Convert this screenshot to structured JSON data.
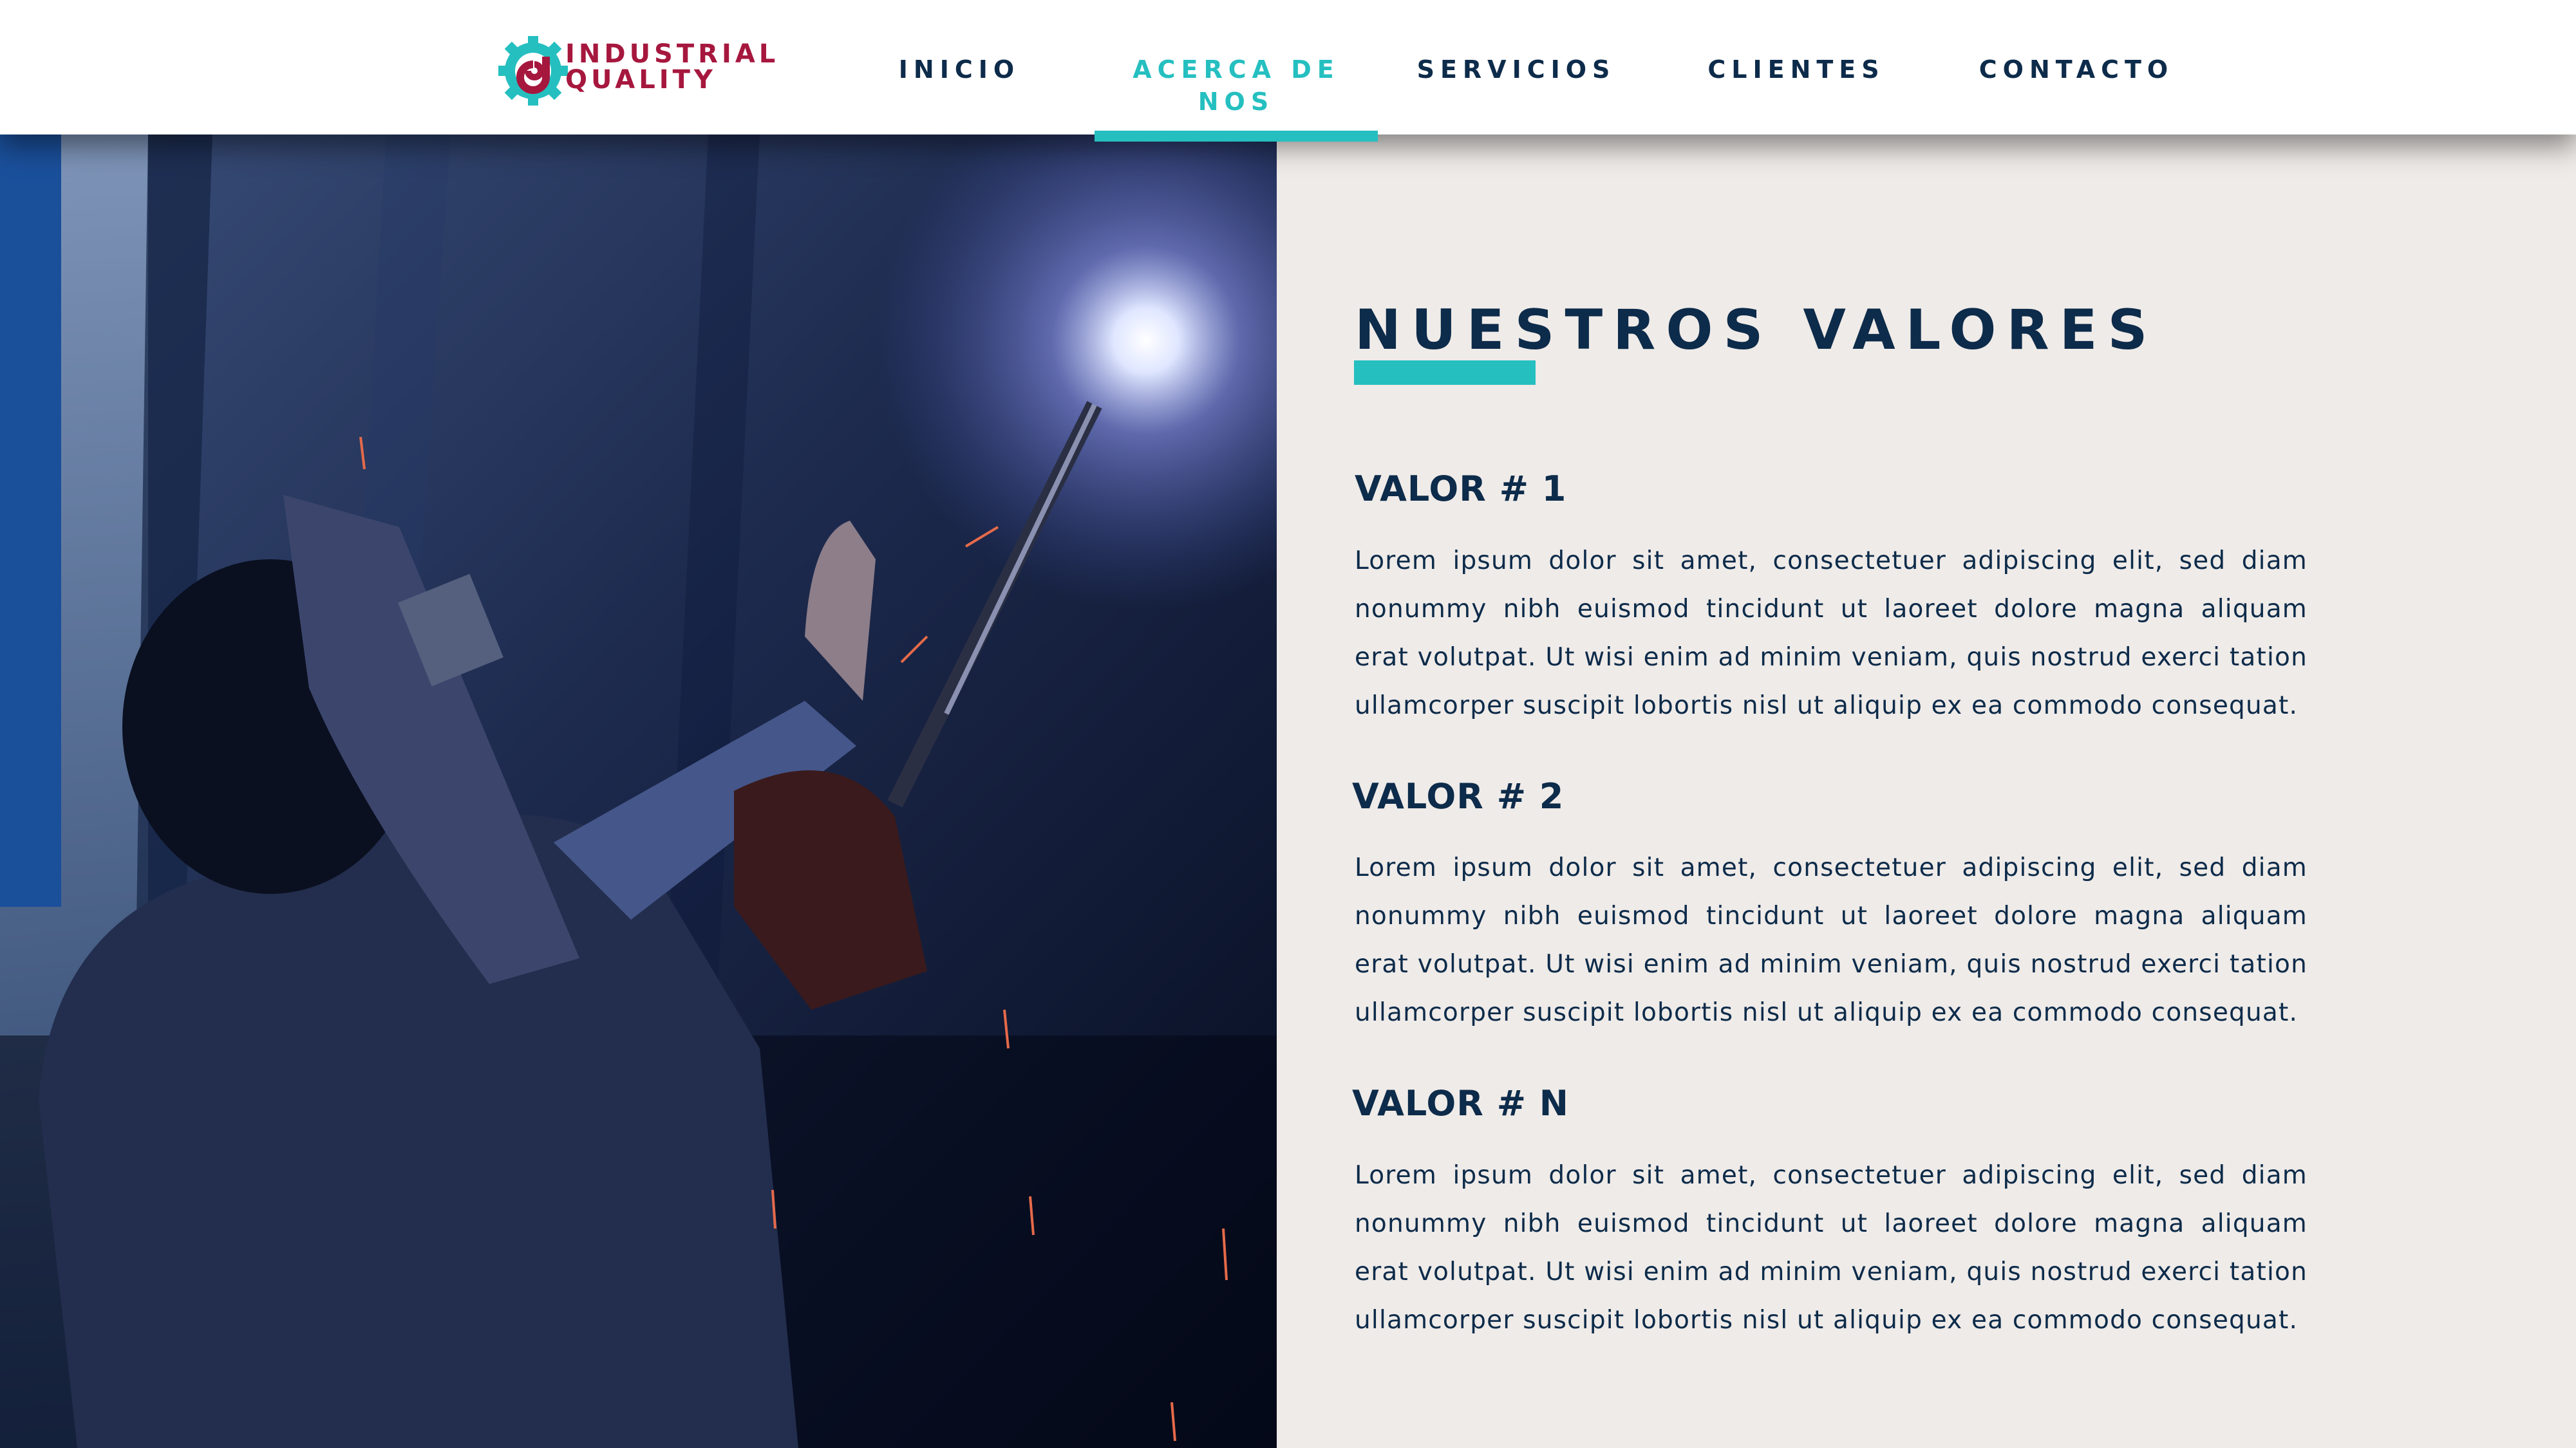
{
  "brand": {
    "line1": "INDUSTRIAL",
    "line2": "QUALITY",
    "colors": {
      "primary": "#a6173e",
      "accent": "#25bfc0"
    }
  },
  "nav": {
    "items": [
      {
        "label": "INICIO",
        "active": false
      },
      {
        "label": "ACERCA DE NOS",
        "active": true
      },
      {
        "label": "SERVICIOS",
        "active": false
      },
      {
        "label": "CLIENTES",
        "active": false
      },
      {
        "label": "CONTACTO",
        "active": false
      }
    ]
  },
  "hero_image": {
    "icon": "welder-photo"
  },
  "section": {
    "title": "NUESTROS VALORES",
    "values": [
      {
        "title": "VALOR # 1",
        "text": "Lorem ipsum dolor sit amet, consectetuer adipiscing elit, sed diam nonummy nibh euismod tincidunt ut laoreet dolore magna aliquam erat volutpat. Ut wisi enim ad minim veniam, quis nostrud exerci tation ullamcorper suscipit lobortis nisl ut aliquip ex ea commodo consequat."
      },
      {
        "title": "VALOR # 2",
        "text": "Lorem ipsum dolor sit amet, consectetuer adipiscing elit, sed diam nonummy nibh euismod tincidunt ut laoreet dolore magna aliquam erat volutpat. Ut wisi enim ad minim veniam, quis nostrud exerci tation ullamcorper suscipit lobortis nisl ut aliquip ex ea commodo consequat."
      },
      {
        "title": "VALOR # N",
        "text": "Lorem ipsum dolor sit amet, consectetuer adipiscing elit, sed diam nonummy nibh euismod tincidunt ut laoreet dolore magna aliquam erat volutpat. Ut wisi enim ad minim veniam, quis nostrud exerci tation ullamcorper suscipit lobortis nisl ut aliquip ex ea commodo consequat."
      }
    ]
  },
  "colors": {
    "navy": "#0d2b4a",
    "teal": "#25bfc0",
    "background": "#efebe8"
  }
}
